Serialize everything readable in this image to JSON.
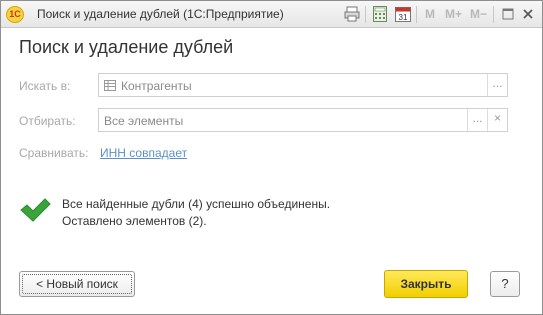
{
  "window": {
    "app_badge": "1С",
    "title": "Поиск и удаление дублей  (1С:Предприятие)",
    "toolbar": {
      "mem1": "M",
      "mem2": "M+",
      "mem3": "M−",
      "calendar_day": "31"
    }
  },
  "form": {
    "heading": "Поиск и удаление дублей",
    "search_in": {
      "label": "Искать в:",
      "value": "Контрагенты",
      "select_button": "..."
    },
    "filter": {
      "label": "Отбирать:",
      "value": "Все элементы",
      "select_button": "...",
      "clear_button": "×"
    },
    "compare": {
      "label": "Сравнивать:",
      "link": "ИНН совпадает"
    },
    "result": {
      "line1": "Все найденные дубли (4) успешно объединены.",
      "line2": "Оставлено элементов (2)."
    },
    "buttons": {
      "new_search": "< Новый поиск",
      "close": "Закрыть",
      "help": "?"
    }
  },
  "colors": {
    "accent_button": "#f2cf00",
    "check": "#3aa43a",
    "link": "#5b8fc9"
  }
}
